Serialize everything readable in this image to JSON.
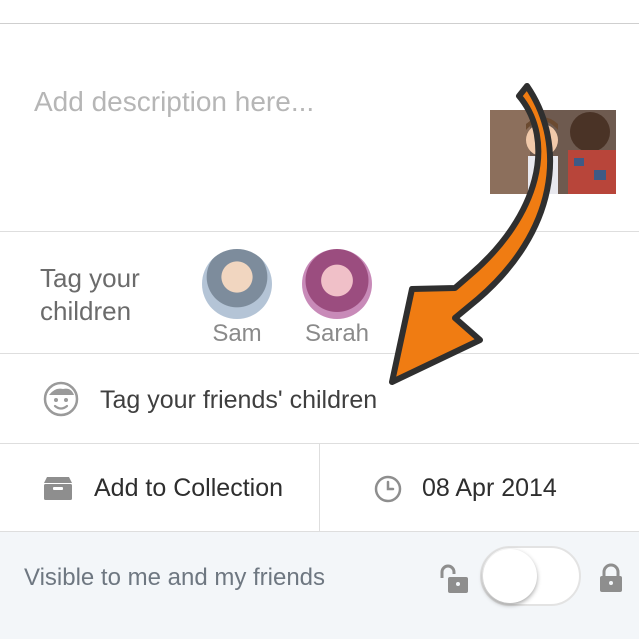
{
  "description": {
    "placeholder": "Add description here..."
  },
  "tag_children": {
    "label": "Tag your children",
    "children": [
      {
        "name": "Sam"
      },
      {
        "name": "Sarah"
      }
    ]
  },
  "friends_children": {
    "label": "Tag your friends' children",
    "icon": "smiley-face-icon"
  },
  "collection": {
    "label": "Add to Collection",
    "icon": "box-icon"
  },
  "date": {
    "label": "08 Apr 2014",
    "icon": "clock-icon"
  },
  "visibility": {
    "label": "Visible to me and my friends",
    "toggle_on": false
  },
  "colors": {
    "arrow": "#f07c12",
    "visibility_background": "#f3f6f9"
  }
}
